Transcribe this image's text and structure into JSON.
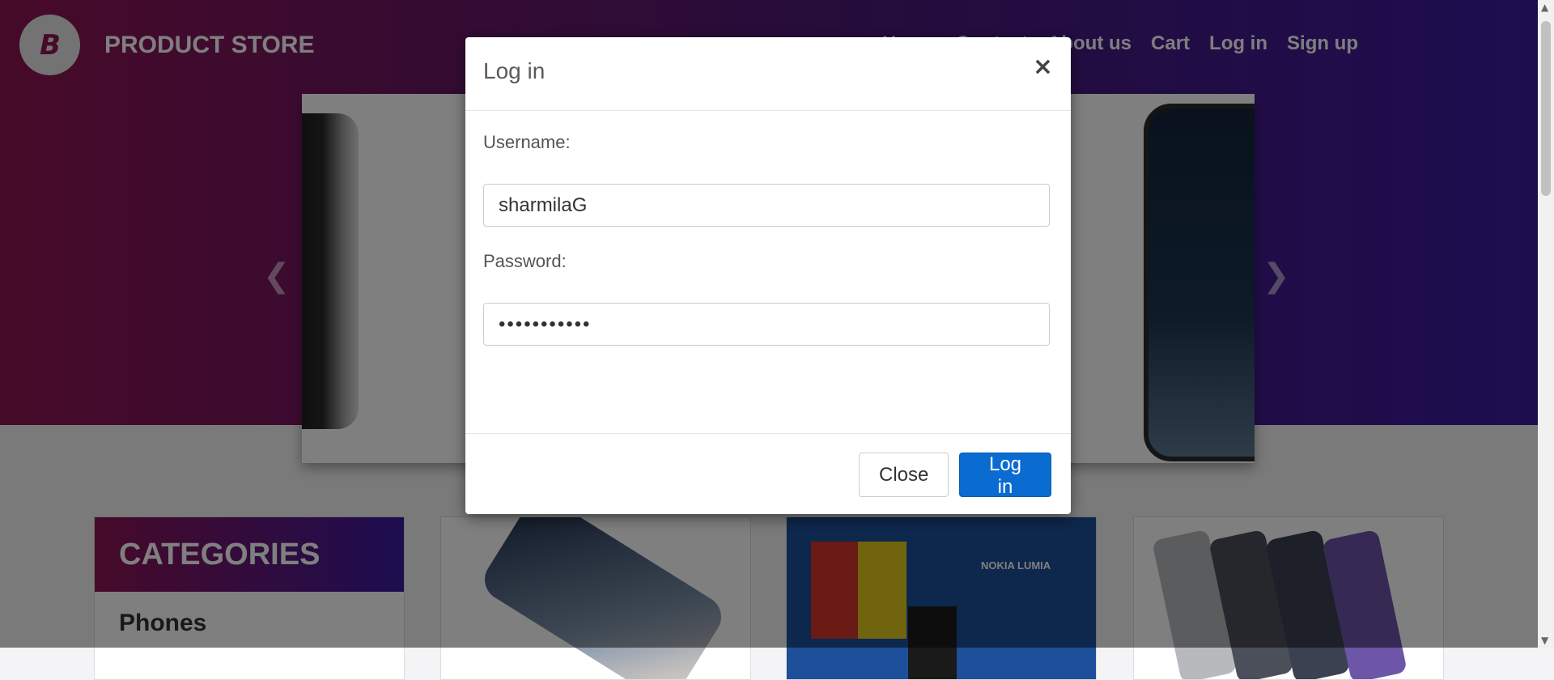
{
  "brand": {
    "logo_letter": "B",
    "name": "PRODUCT STORE"
  },
  "nav": {
    "items": [
      "Home",
      "Contact",
      "About us",
      "Cart",
      "Log in",
      "Sign up"
    ]
  },
  "carousel": {
    "prev_icon": "chevron-left-icon",
    "next_icon": "chevron-right-icon"
  },
  "categories": {
    "heading": "CATEGORIES",
    "items": [
      "Phones"
    ]
  },
  "cards": {
    "card2_text": "NOKIA LUMIA"
  },
  "modal": {
    "title": "Log in",
    "close_icon": "×",
    "username_label": "Username:",
    "username_value": "sharmilaG",
    "password_label": "Password:",
    "password_value": "•••••••••••",
    "close_button": "Close",
    "login_button": "Log in"
  },
  "colors": {
    "hero_start": "#8e1452",
    "hero_end": "#3b1aa0",
    "primary_button": "#0a6bd0"
  }
}
